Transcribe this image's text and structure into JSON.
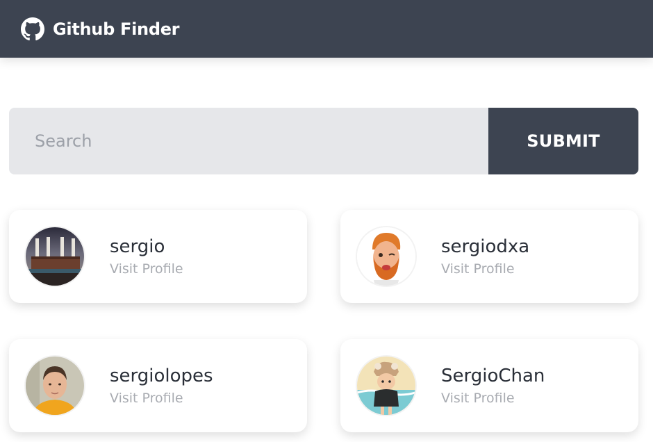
{
  "navbar": {
    "logo_icon": "github-icon",
    "title": "Github Finder"
  },
  "search": {
    "placeholder": "Search",
    "value": "",
    "submit_label": "SUBMIT"
  },
  "users": [
    {
      "username": "sergio",
      "link_label": "Visit Profile",
      "avatar_icon": "factory-photo-avatar"
    },
    {
      "username": "sergiodxa",
      "link_label": "Visit Profile",
      "avatar_icon": "memoji-avatar"
    },
    {
      "username": "sergiolopes",
      "link_label": "Visit Profile",
      "avatar_icon": "person-photo-avatar"
    },
    {
      "username": "SergioChan",
      "link_label": "Visit Profile",
      "avatar_icon": "cartoon-avatar"
    }
  ],
  "colors": {
    "navbar_bg": "#3d4451",
    "input_bg": "#e6e7ea",
    "button_bg": "#3d4451",
    "link_text": "#a8abb1"
  }
}
